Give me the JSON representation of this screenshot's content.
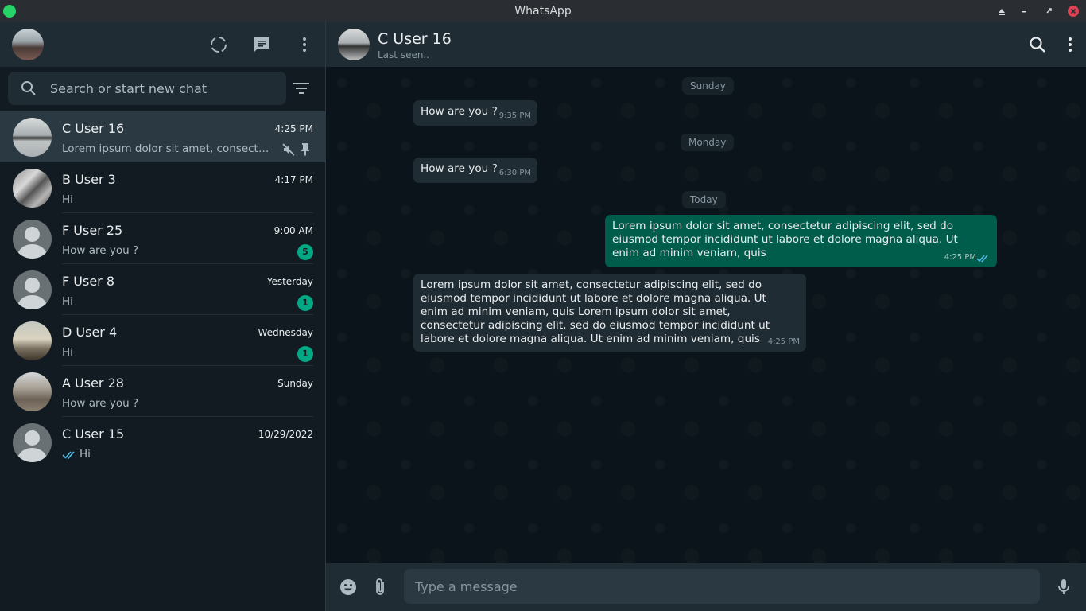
{
  "window": {
    "title": "WhatsApp"
  },
  "sidebar": {
    "search_placeholder": "Search or start new chat",
    "chats": [
      {
        "name": "C User 16",
        "time": "4:25 PM",
        "preview": "Lorem ipsum dolor sit amet, consectetur …",
        "active": true,
        "muted": true,
        "pinned": true
      },
      {
        "name": "B User 3",
        "time": "4:17 PM",
        "preview": "Hi"
      },
      {
        "name": "F User 25",
        "time": "9:00 AM",
        "preview": "How are you ?",
        "unread": "5"
      },
      {
        "name": "F User 8",
        "time": "Yesterday",
        "preview": "Hi",
        "unread": "1"
      },
      {
        "name": "D User 4",
        "time": "Wednesday",
        "preview": "Hi",
        "unread": "1"
      },
      {
        "name": "A User 28",
        "time": "Sunday",
        "preview": "How are you ?"
      },
      {
        "name": "C User 15",
        "time": "10/29/2022",
        "preview": "Hi",
        "read_ticks": true
      }
    ]
  },
  "conversation": {
    "contact_name": "C User 16",
    "contact_status": "Last seen..",
    "days": [
      "Sunday",
      "Monday",
      "Today"
    ],
    "messages": [
      {
        "text": "How are you ?",
        "time": "9:35 PM"
      },
      {
        "text": "How are you ?",
        "time": "6:30 PM"
      },
      {
        "text": "Lorem ipsum dolor sit amet, consectetur adipiscing elit, sed do eiusmod tempor incididunt ut labore et dolore magna aliqua. Ut enim ad minim veniam, quis",
        "time": "4:25 PM"
      },
      {
        "text": "Lorem ipsum dolor sit amet, consectetur adipiscing elit, sed do eiusmod tempor incididunt ut labore et dolore magna aliqua. Ut enim ad minim veniam, quis Lorem ipsum dolor sit amet, consectetur adipiscing elit, sed do eiusmod tempor incididunt ut labore et dolore magna aliqua. Ut enim ad minim veniam, quis",
        "time": "4:25 PM"
      }
    ]
  },
  "composer": {
    "placeholder": "Type a message"
  },
  "colors": {
    "accent": "#00a884",
    "outgoing": "#005c4b",
    "incoming": "#202c33",
    "panel": "#202c33",
    "background": "#0b141a"
  }
}
